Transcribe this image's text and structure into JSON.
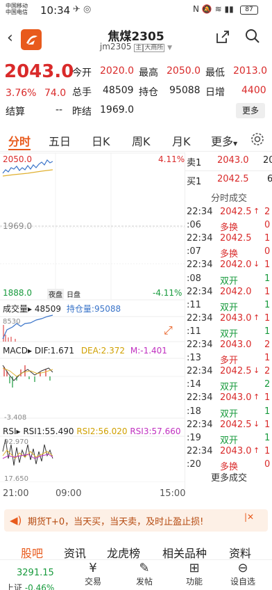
{
  "status": {
    "carrier1": "中国移动",
    "carrier2": "中国电信",
    "time": "10:34",
    "battery": "87"
  },
  "header": {
    "title": "焦煤2305",
    "subtitle": "jm2305",
    "tag1": "主",
    "tag2": "大商所"
  },
  "quote": {
    "price": "2043.0",
    "change_pct": "3.76%",
    "change_abs": "74.0",
    "open_label": "今开",
    "open": "2020.0",
    "high_label": "最高",
    "high": "2050.0",
    "low_label": "最低",
    "low": "2013.0",
    "vol_label": "总手",
    "vol": "48509",
    "oi_label": "持仓",
    "oi": "95088",
    "inc_label": "日增",
    "inc": "4400",
    "settle_label": "结算",
    "settle": "--",
    "prev_label": "昨结",
    "prev": "1969.0",
    "more": "更多"
  },
  "tabs": [
    "分时",
    "五日",
    "日K",
    "周K",
    "月K",
    "更多"
  ],
  "chart": {
    "top_price": "2050.0",
    "top_pct": "4.11%",
    "mid_price": "1969.0",
    "bottom_price": "1888.0",
    "bottom_pct": "-4.11%",
    "night_label": "夜盘",
    "day_label": "日盘",
    "vol_label": "成交量",
    "vol_value": "48509",
    "oi_label": "持仓量",
    "oi_value": "95088",
    "vol_axis": "8530",
    "macd_label": "MACD",
    "dif": "DIF:1.671",
    "dea": "DEA:2.372",
    "m": "M:-1.401",
    "macd_low": "-3.408",
    "rsi_label": "RSI",
    "rsi1": "RSI1:55.490",
    "rsi2": "RSI2:56.020",
    "rsi3": "RSI3:57.660",
    "rsi_high": "92.970",
    "rsi_low": "17.650",
    "t_start": "21:00",
    "t_mid": "09:00",
    "t_end": "15:00"
  },
  "orderbook": {
    "sell_label": "卖1",
    "sell_price": "2043.0",
    "sell_qty": "20",
    "buy_label": "买1",
    "buy_price": "2042.5",
    "buy_qty": "6",
    "trades_title": "分时成交",
    "more": "更多成交"
  },
  "trades": [
    {
      "time": "22:34",
      "price": "2042.5",
      "dir": "↑",
      "qty": "2",
      "pc": "red"
    },
    {
      "time": ":06",
      "price": "多换",
      "dir": "",
      "qty": "0",
      "pc": "red"
    },
    {
      "time": "22:34",
      "price": "2042.5",
      "dir": "",
      "qty": "1",
      "pc": "red"
    },
    {
      "time": ":07",
      "price": "多换",
      "dir": "",
      "qty": "0",
      "pc": "red"
    },
    {
      "time": "22:34",
      "price": "2042.0",
      "dir": "↓",
      "qty": "1",
      "pc": "red"
    },
    {
      "time": ":08",
      "price": "双开",
      "dir": "",
      "qty": "1",
      "pc": "green"
    },
    {
      "time": "22:34",
      "price": "2042.0",
      "dir": "",
      "qty": "1",
      "pc": "red"
    },
    {
      "time": ":11",
      "price": "双开",
      "dir": "",
      "qty": "1",
      "pc": "green"
    },
    {
      "time": "22:34",
      "price": "2043.0",
      "dir": "↑",
      "qty": "1",
      "pc": "red"
    },
    {
      "time": ":11",
      "price": "双开",
      "dir": "",
      "qty": "1",
      "pc": "green"
    },
    {
      "time": "22:34",
      "price": "2043.0",
      "dir": "",
      "qty": "2",
      "pc": "red"
    },
    {
      "time": ":13",
      "price": "多开",
      "dir": "",
      "qty": "1",
      "pc": "red"
    },
    {
      "time": "22:34",
      "price": "2042.5",
      "dir": "↓",
      "qty": "2",
      "pc": "red"
    },
    {
      "time": ":14",
      "price": "双开",
      "dir": "",
      "qty": "2",
      "pc": "green"
    },
    {
      "time": "22:34",
      "price": "2043.0",
      "dir": "↑",
      "qty": "1",
      "pc": "red"
    },
    {
      "time": ":18",
      "price": "双开",
      "dir": "",
      "qty": "1",
      "pc": "green"
    },
    {
      "time": "22:34",
      "price": "2042.5",
      "dir": "↓",
      "qty": "1",
      "pc": "red"
    },
    {
      "time": ":19",
      "price": "双开",
      "dir": "",
      "qty": "1",
      "pc": "green"
    },
    {
      "time": "22:34",
      "price": "2043.0",
      "dir": "↑",
      "qty": "1",
      "pc": "red"
    },
    {
      "time": ":20",
      "price": "多换",
      "dir": "",
      "qty": "0",
      "pc": "red"
    }
  ],
  "banner": {
    "text": "期货T+0，当天买，当天卖，及时止盈止损!"
  },
  "bottom_tabs": [
    "股吧",
    "资讯",
    "龙虎榜",
    "相关品种",
    "资料"
  ],
  "bottomnav": {
    "index_value": "3291.15",
    "index_change": "-0.46%",
    "items": [
      "交易",
      "发帖",
      "功能",
      "设自选"
    ]
  },
  "colors": {
    "red": "#d92a2a",
    "green": "#179a3c",
    "accent": "#e85a1c"
  }
}
